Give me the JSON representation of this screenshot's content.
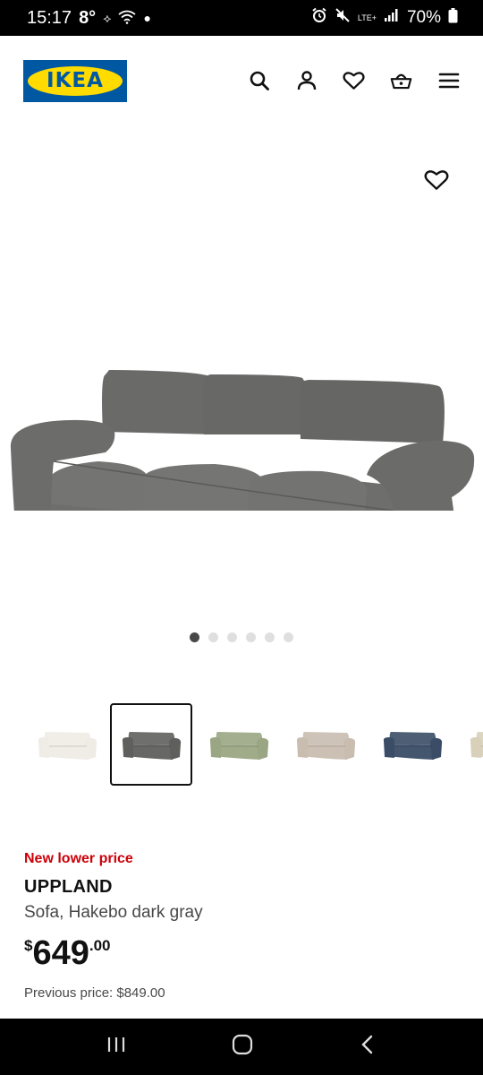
{
  "status_bar": {
    "time": "15:17",
    "temperature": "8°",
    "battery": "70%",
    "lte_label": "LTE+"
  },
  "header": {
    "logo_text": "IKEA",
    "icons": [
      "search-icon",
      "user-icon",
      "heart-icon",
      "basket-icon",
      "menu-icon"
    ]
  },
  "gallery": {
    "image_count": 6,
    "active_index": 0
  },
  "color_variants": [
    {
      "name": "white",
      "color": "#efece6"
    },
    {
      "name": "dark gray",
      "color": "#5f5f5d",
      "selected": true
    },
    {
      "name": "green",
      "color": "#9aa683"
    },
    {
      "name": "beige stripe",
      "color": "#c9bdb0"
    },
    {
      "name": "blue",
      "color": "#3a4c66"
    },
    {
      "name": "beige",
      "color": "#d8d0b8"
    }
  ],
  "product": {
    "badge": "New lower price",
    "name": "UPPLAND",
    "description": "Sofa, Hakebo dark gray",
    "price_currency": "$",
    "price_integer": "649",
    "price_decimal": ".00",
    "previous_price": "Previous price: $849.00"
  },
  "colors": {
    "brand_blue": "#0058a3",
    "brand_yellow": "#ffdb00",
    "sale_red": "#cc0008"
  }
}
